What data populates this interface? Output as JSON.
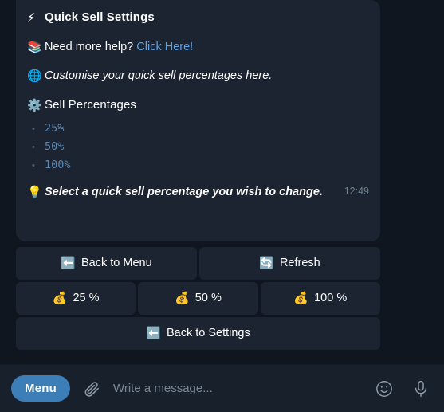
{
  "message": {
    "title": {
      "emoji": "⚡",
      "icon_name": "lightning-icon",
      "text": "Quick Sell Settings"
    },
    "help": {
      "emoji": "📚",
      "icon_name": "books-icon",
      "text": "Need more help?",
      "link_label": "Click Here!"
    },
    "description": {
      "emoji": "🌐",
      "icon_name": "globe-icon",
      "text": "Customise your quick sell percentages here."
    },
    "section": {
      "emoji": "⚙️",
      "icon_name": "gear-icon",
      "text": "Sell Percentages"
    },
    "percent_list": [
      "25%",
      "50%",
      "100%"
    ],
    "tip": {
      "emoji": "💡",
      "icon_name": "lightbulb-icon",
      "text": "Select a quick sell percentage you wish to change."
    },
    "timestamp": "12:49"
  },
  "keyboard": {
    "rows": [
      [
        {
          "emoji": "⬅️",
          "icon_name": "back-arrow-icon",
          "label": "Back to Menu"
        },
        {
          "emoji": "🔄",
          "icon_name": "refresh-icon",
          "label": "Refresh"
        }
      ],
      [
        {
          "emoji": "💰",
          "icon_name": "money-bag-icon",
          "label": "25 %"
        },
        {
          "emoji": "💰",
          "icon_name": "money-bag-icon",
          "label": "50 %"
        },
        {
          "emoji": "💰",
          "icon_name": "money-bag-icon",
          "label": "100 %"
        }
      ],
      [
        {
          "emoji": "⬅️",
          "icon_name": "back-arrow-icon",
          "label": "Back to Settings"
        }
      ]
    ]
  },
  "composer": {
    "menu_label": "Menu",
    "placeholder": "Write a message...",
    "input_value": ""
  },
  "colors": {
    "page_background": "#0f1620",
    "bubble_background": "#1b2430",
    "link": "#62a2e0",
    "code_text": "#5d88b3",
    "accent_button": "#3c7eb8",
    "timestamp": "#6a7f93"
  }
}
